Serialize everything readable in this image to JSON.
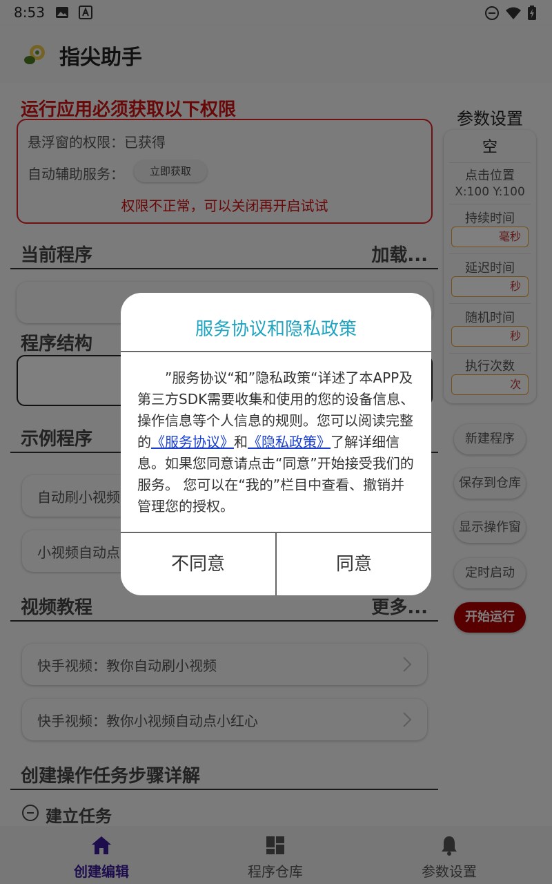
{
  "status_bar": {
    "time": "8:53"
  },
  "app_bar": {
    "title": "指尖助手"
  },
  "permissions": {
    "title": "运行应用必须获取以下权限",
    "overlay_label": "悬浮窗的权限：已获得",
    "accessibility_label": "自动辅助服务：",
    "acquire_button": "立即获取",
    "warning": "权限不正常，可以关闭再开启试试"
  },
  "current_program": {
    "title": "当前程序",
    "loading": "加载..."
  },
  "program_structure": {
    "title": "程序结构"
  },
  "examples": {
    "title": "示例程序",
    "items": [
      {
        "label": "自动刷小视频"
      },
      {
        "label": "小视频自动点"
      }
    ]
  },
  "tutorials": {
    "title": "视频教程",
    "more": "更多...",
    "items": [
      {
        "label": "快手视频：教你自动刷小视频"
      },
      {
        "label": "快手视频：教你小视频自动点小红心"
      }
    ]
  },
  "steps": {
    "title": "创建操作任务步骤详解",
    "first_step": "建立任务"
  },
  "params": {
    "title": "参数设置",
    "empty": "空",
    "click_position_label": "点击位置",
    "click_position_value": "X:100  Y:100",
    "duration_label": "持续时间",
    "duration_unit": "毫秒",
    "delay_label": "延迟时间",
    "delay_unit": "秒",
    "random_label": "随机时间",
    "random_unit": "秒",
    "repeat_label": "执行次数",
    "repeat_unit": "次"
  },
  "side_buttons": {
    "new_program": "新建程序",
    "save_to_repo": "保存到仓库",
    "show_window": "显示操作窗",
    "timed_start": "定时启动",
    "start_run": "开始运行"
  },
  "bottom_nav": {
    "items": [
      {
        "label": "创建编辑",
        "icon": "home-icon"
      },
      {
        "label": "程序仓库",
        "icon": "grid-icon"
      },
      {
        "label": "参数设置",
        "icon": "bell-icon"
      }
    ]
  },
  "dialog": {
    "title": "服务协议和隐私政策",
    "body_part1": "”服务协议“和”隐私政策“详述了本APP及第三方SDK需要收集和使用的您的设备信息、操作信息等个人信息的规则。您可以阅读完整的",
    "link_service": "《服务协议》",
    "and_text": "和",
    "link_privacy": "《隐私政策》",
    "body_part2": "了解详细信息。如果您同意请点击“同意”开始接受我们的服务。 您可以在“我的”栏目中查看、撤销并管理您的授权。",
    "disagree": "不同意",
    "agree": "同意"
  },
  "colors": {
    "accent_red": "#d01010",
    "dialog_title": "#1ea4c0",
    "link_blue": "#1a3fd0",
    "run_button": "#b00000",
    "nav_active": "#3a1a9a"
  }
}
